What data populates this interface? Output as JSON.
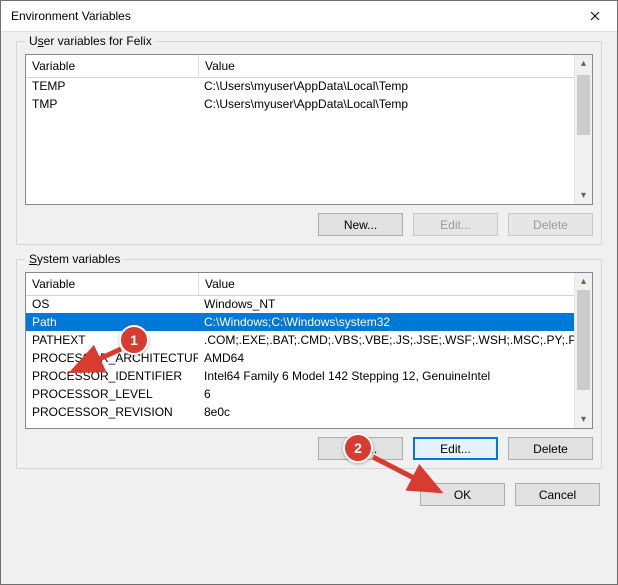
{
  "window": {
    "title": "Environment Variables"
  },
  "user": {
    "group_label_before": "U",
    "group_label_underlined": "s",
    "group_label_after": "er variables for Felix",
    "columns": {
      "var": "Variable",
      "val": "Value"
    },
    "rows": [
      {
        "var": "TEMP",
        "val": "C:\\Users\\myuser\\AppData\\Local\\Temp"
      },
      {
        "var": "TMP",
        "val": "C:\\Users\\myuser\\AppData\\Local\\Temp"
      }
    ],
    "buttons": {
      "new": "New...",
      "edit": "Edit...",
      "delete": "Delete"
    }
  },
  "system": {
    "group_label_before": "",
    "group_label_underlined": "S",
    "group_label_after": "ystem variables",
    "columns": {
      "var": "Variable",
      "val": "Value"
    },
    "rows": [
      {
        "var": "OS",
        "val": "Windows_NT"
      },
      {
        "var": "Path",
        "val": "C:\\Windows;C:\\Windows\\system32",
        "selected": true
      },
      {
        "var": "PATHEXT",
        "val": ".COM;.EXE;.BAT;.CMD;.VBS;.VBE;.JS;.JSE;.WSF;.WSH;.MSC;.PY;.PYW"
      },
      {
        "var": "PROCESSOR_ARCHITECTURE",
        "val": "AMD64"
      },
      {
        "var": "PROCESSOR_IDENTIFIER",
        "val": "Intel64 Family 6 Model 142 Stepping 12, GenuineIntel"
      },
      {
        "var": "PROCESSOR_LEVEL",
        "val": "6"
      },
      {
        "var": "PROCESSOR_REVISION",
        "val": "8e0c"
      }
    ],
    "buttons": {
      "new": "New...",
      "edit": "Edit...",
      "delete": "Delete"
    }
  },
  "bottom": {
    "ok": "OK",
    "cancel": "Cancel"
  },
  "annotations": {
    "c1": "1",
    "c2": "2"
  }
}
